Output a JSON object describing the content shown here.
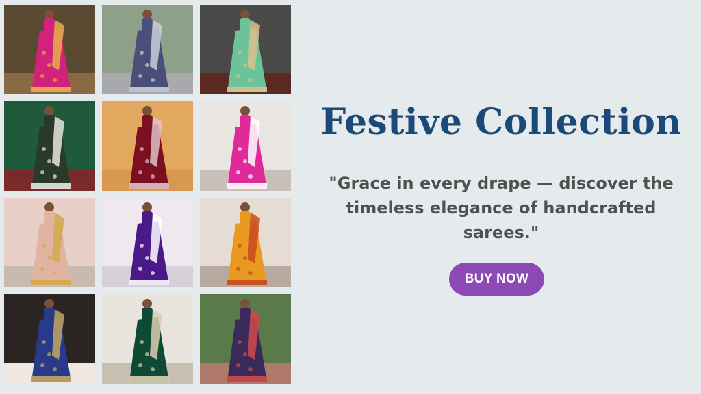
{
  "hero": {
    "title": "Festive Collection",
    "tagline": "\"Grace in every drape — discover the timeless elegance of handcrafted sarees.\"",
    "cta_label": "BUY NOW"
  },
  "colors": {
    "background": "#e5eaec",
    "title": "#1c4a78",
    "text": "#505050",
    "button": "#8d4ab6"
  },
  "gallery": [
    {
      "bg": "#5b4a32",
      "floor": "#8a6a44",
      "saree": "#d2237a",
      "accent": "#e7b04a"
    },
    {
      "bg": "#8fa08a",
      "floor": "#a9a9ad",
      "saree": "#4a4f7a",
      "accent": "#c9ccd8"
    },
    {
      "bg": "#4a4a48",
      "floor": "#5a2a22",
      "saree": "#6cc39a",
      "accent": "#d9c28a"
    },
    {
      "bg": "#1f5a3a",
      "floor": "#7a2a2a",
      "saree": "#2a3a2a",
      "accent": "#e8e8e0"
    },
    {
      "bg": "#e2a860",
      "floor": "#d89850",
      "saree": "#7a1020",
      "accent": "#e0c0c8"
    },
    {
      "bg": "#e9e6e2",
      "floor": "#c8c0b8",
      "saree": "#e02a9a",
      "accent": "#ffffff"
    },
    {
      "bg": "#e8d0c8",
      "floor": "#c8bab0",
      "saree": "#e0b4a0",
      "accent": "#d4a84a"
    },
    {
      "bg": "#efe8ee",
      "floor": "#d8d0d8",
      "saree": "#4a1a8a",
      "accent": "#ffffff"
    },
    {
      "bg": "#e6dcd4",
      "floor": "#b8aaa0",
      "saree": "#e89a20",
      "accent": "#c84a20"
    },
    {
      "bg": "#2a2522",
      "floor": "#f0e8e0",
      "saree": "#2a3a8a",
      "accent": "#c0a860"
    },
    {
      "bg": "#e8e4de",
      "floor": "#c8c0b0",
      "saree": "#0e4a36",
      "accent": "#d8d0b0"
    },
    {
      "bg": "#5a7a4a",
      "floor": "#b07a6a",
      "saree": "#3a2a5a",
      "accent": "#d04a4a"
    }
  ]
}
